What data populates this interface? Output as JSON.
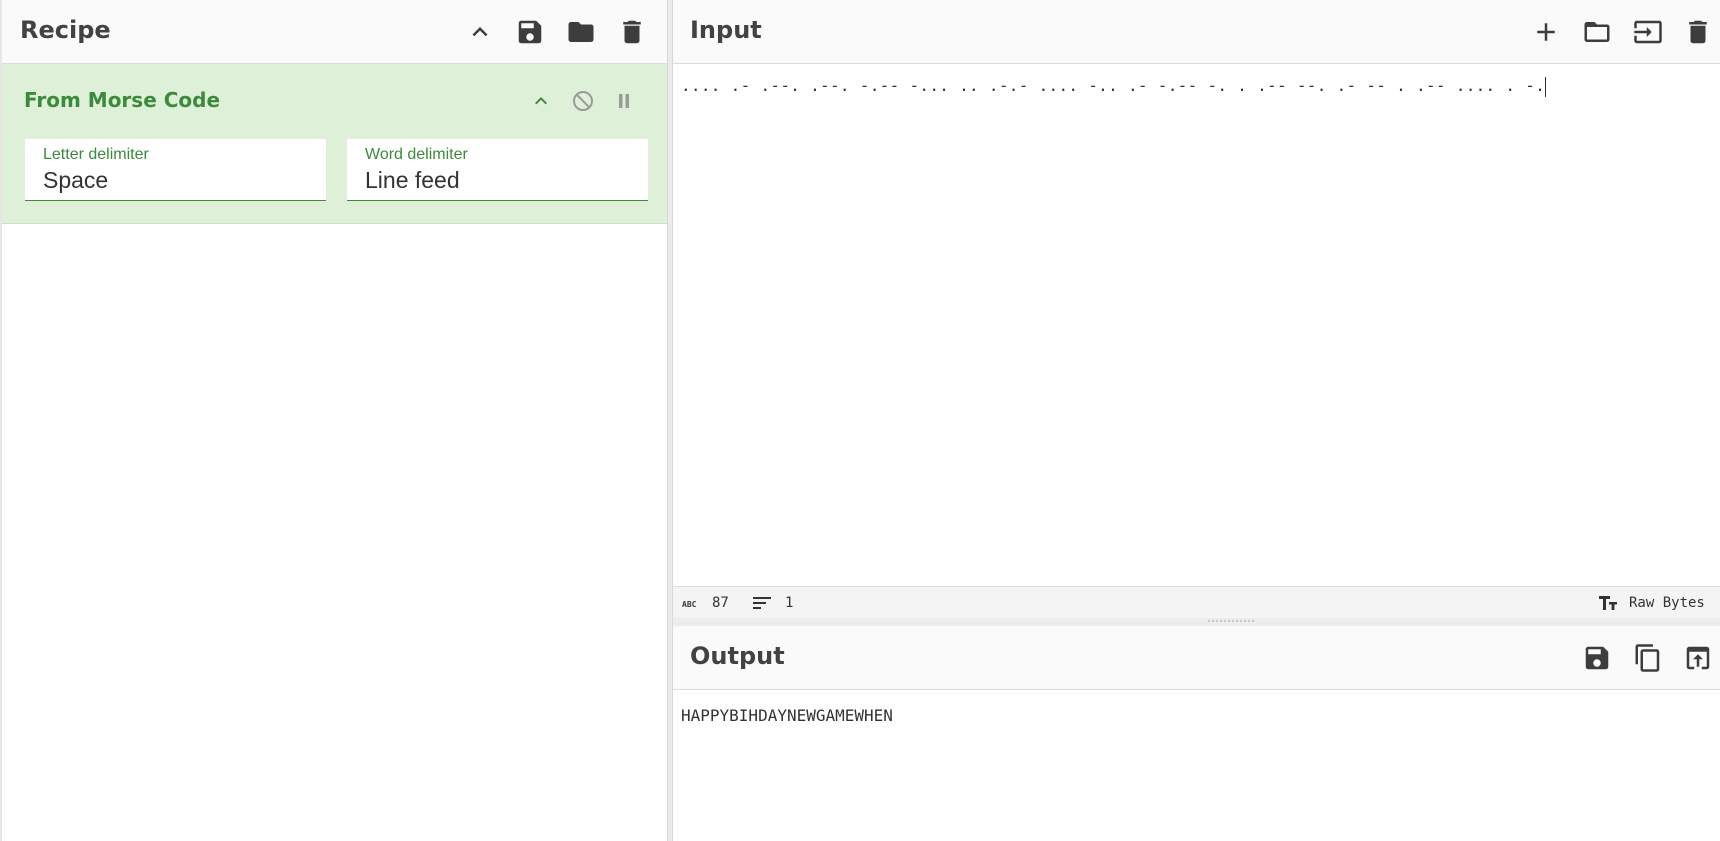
{
  "recipe": {
    "title": "Recipe",
    "operation": {
      "name": "From Morse Code",
      "args": [
        {
          "label": "Letter delimiter",
          "value": "Space"
        },
        {
          "label": "Word delimiter",
          "value": "Line feed"
        }
      ]
    }
  },
  "input": {
    "title": "Input",
    "text": ".... .- .--. .--. -.-- -... .. .-.- .... -.. .- -.-- -. . .-- --. .- -- . .-- .... . -.",
    "length": "87",
    "lines": "1",
    "encoding": "Raw Bytes"
  },
  "output": {
    "title": "Output",
    "text": "HAPPYBIHDAYNEWGAMEWHEN"
  },
  "colors": {
    "accent_green": "#3c8a3c",
    "operation_bg": "#dff0d8"
  },
  "icons": {
    "recipe_toolbar": [
      "chevron-up-icon",
      "save-icon",
      "folder-icon",
      "trash-icon"
    ],
    "operation_controls": [
      "chevron-up-icon",
      "disable-icon",
      "pause-icon"
    ],
    "input_toolbar": [
      "plus-icon",
      "folder-icon",
      "import-icon",
      "trash-icon"
    ],
    "output_toolbar": [
      "save-icon",
      "copy-icon",
      "open-in-input-icon"
    ]
  }
}
